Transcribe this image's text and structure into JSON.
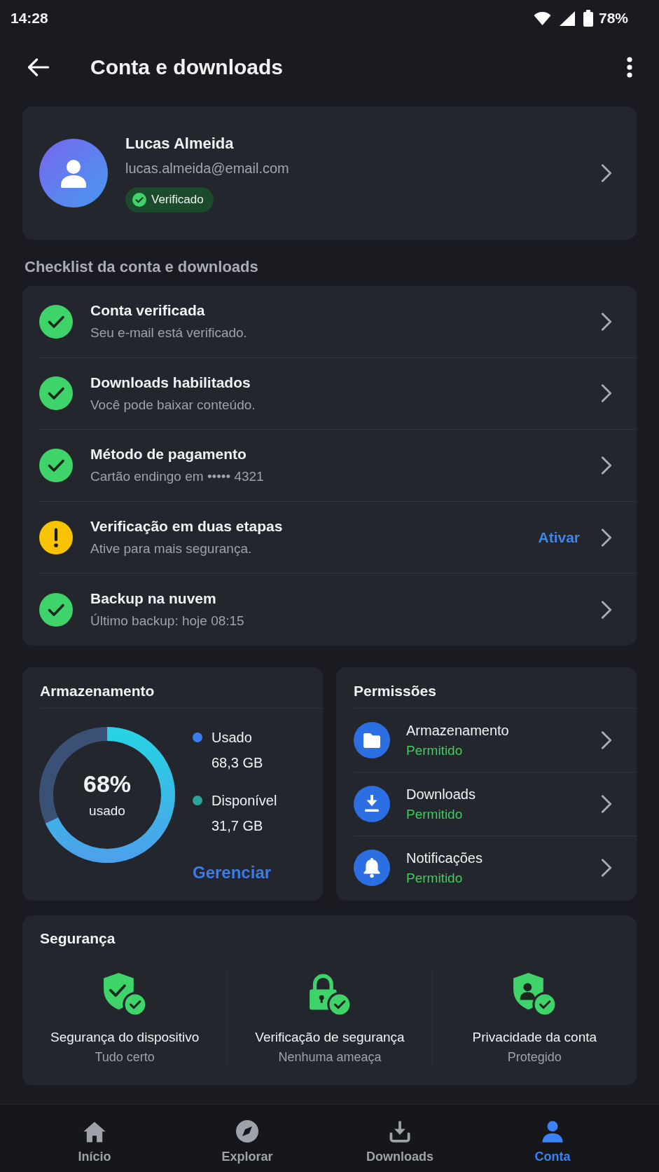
{
  "status_bar": {
    "time": "14:28",
    "battery": "78%"
  },
  "header": {
    "title": "Conta e downloads"
  },
  "profile": {
    "name": "Lucas Almeida",
    "email": "lucas.almeida@email.com",
    "badge": "Verificado"
  },
  "checklist": {
    "title": "Checklist da conta e downloads",
    "items": [
      {
        "kind": "done",
        "title": "Conta verificada",
        "subtitle": "Seu e-mail está verificado."
      },
      {
        "kind": "done",
        "title": "Downloads habilitados",
        "subtitle": "Você pode baixar conteúdo."
      },
      {
        "kind": "done",
        "title": "Método de pagamento",
        "subtitle": "Cartão endingo em ••••• 4321"
      },
      {
        "kind": "warning",
        "title": "Verificação em duas etapas",
        "subtitle": "Ative para mais segurança.",
        "action": "Ativar"
      },
      {
        "kind": "done",
        "title": "Backup na nuvem",
        "subtitle": "Último backup: hoje 08:15"
      }
    ]
  },
  "storage": {
    "title": "Armazenamento",
    "meter": {
      "level": 0.68,
      "reading": "68%",
      "caption": "usado"
    },
    "legend": [
      {
        "label": "Usado",
        "value": "68,3 GB",
        "color": "#3b7cf0"
      },
      {
        "label": "Disponível",
        "value": "31,7 GB",
        "color": "#2ba397"
      }
    ],
    "action": "Gerenciar"
  },
  "permissions": {
    "title": "Permissões",
    "items": [
      {
        "kind": "folder",
        "label": "Armazenamento",
        "status": "Permitido"
      },
      {
        "kind": "download",
        "label": "Downloads",
        "status": "Permitido"
      },
      {
        "kind": "bell",
        "label": "Notificações",
        "status": "Permitido"
      }
    ]
  },
  "security": {
    "title": "Segurança",
    "items": [
      {
        "kind": "shield",
        "label": "Segurança do dispositivo",
        "status": "Tudo certo"
      },
      {
        "kind": "lock",
        "label": "Verificação de segurança",
        "status": "Nenhuma ameaça"
      },
      {
        "kind": "person",
        "label": "Privacidade da conta",
        "status": "Protegido"
      }
    ]
  },
  "bottom_nav": [
    {
      "kind": "home",
      "label": "Início",
      "selected": false
    },
    {
      "kind": "explore",
      "label": "Explorar",
      "selected": false
    },
    {
      "kind": "downloads",
      "label": "Downloads",
      "selected": false
    },
    {
      "kind": "account",
      "label": "Conta",
      "selected": true
    }
  ]
}
